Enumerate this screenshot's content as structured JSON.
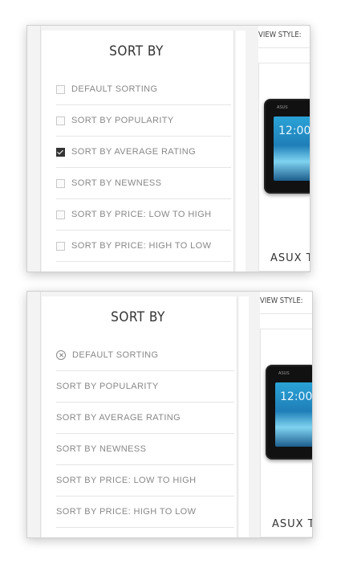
{
  "panels": [
    {
      "sidebar": {
        "title": "SORT BY",
        "items": [
          {
            "label": "DEFAULT SORTING",
            "checked": false
          },
          {
            "label": "SORT BY POPULARITY",
            "checked": false
          },
          {
            "label": "SORT BY AVERAGE RATING",
            "checked": true
          },
          {
            "label": "SORT BY NEWNESS",
            "checked": false
          },
          {
            "label": "SORT BY PRICE: LOW TO HIGH",
            "checked": false
          },
          {
            "label": "SORT BY PRICE: HIGH TO LOW",
            "checked": false
          }
        ]
      },
      "main": {
        "view_style_label": "VIEW STYLE:",
        "product": {
          "name": "ASUX TF",
          "clock": "12:00",
          "brand": "ASUS"
        }
      }
    },
    {
      "sidebar": {
        "title": "SORT BY",
        "items": [
          {
            "label": "DEFAULT SORTING",
            "active_filter": true
          },
          {
            "label": "SORT BY POPULARITY"
          },
          {
            "label": "SORT BY AVERAGE RATING"
          },
          {
            "label": "SORT BY NEWNESS"
          },
          {
            "label": "SORT BY PRICE: LOW TO HIGH"
          },
          {
            "label": "SORT BY PRICE: HIGH TO LOW"
          }
        ]
      },
      "main": {
        "view_style_label": "VIEW STYLE:",
        "product": {
          "name": "ASUX TF",
          "clock": "12:00",
          "brand": "ASUS"
        }
      }
    }
  ]
}
